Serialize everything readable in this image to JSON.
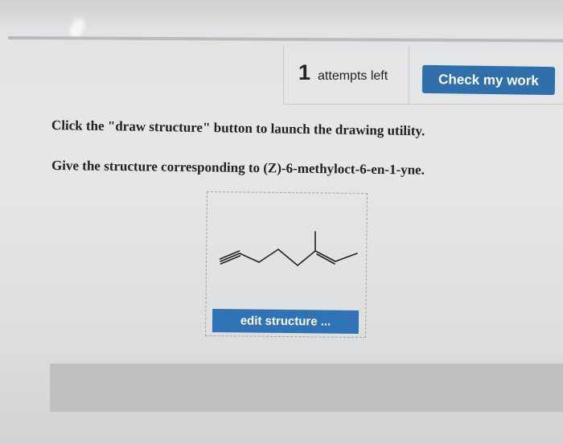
{
  "header": {
    "attempts_count": "1",
    "attempts_label": "attempts left",
    "check_button_label": "Check my work"
  },
  "question": {
    "instruction_1": "Click the \"draw structure\" button to launch the drawing utility.",
    "instruction_2": "Give the structure corresponding to (Z)-6-methyloct-6-en-1-yne."
  },
  "drawing_area": {
    "edit_button_label": "edit structure ..."
  },
  "colors": {
    "button_blue": "#2f6fab",
    "background": "#e4e5e6"
  }
}
